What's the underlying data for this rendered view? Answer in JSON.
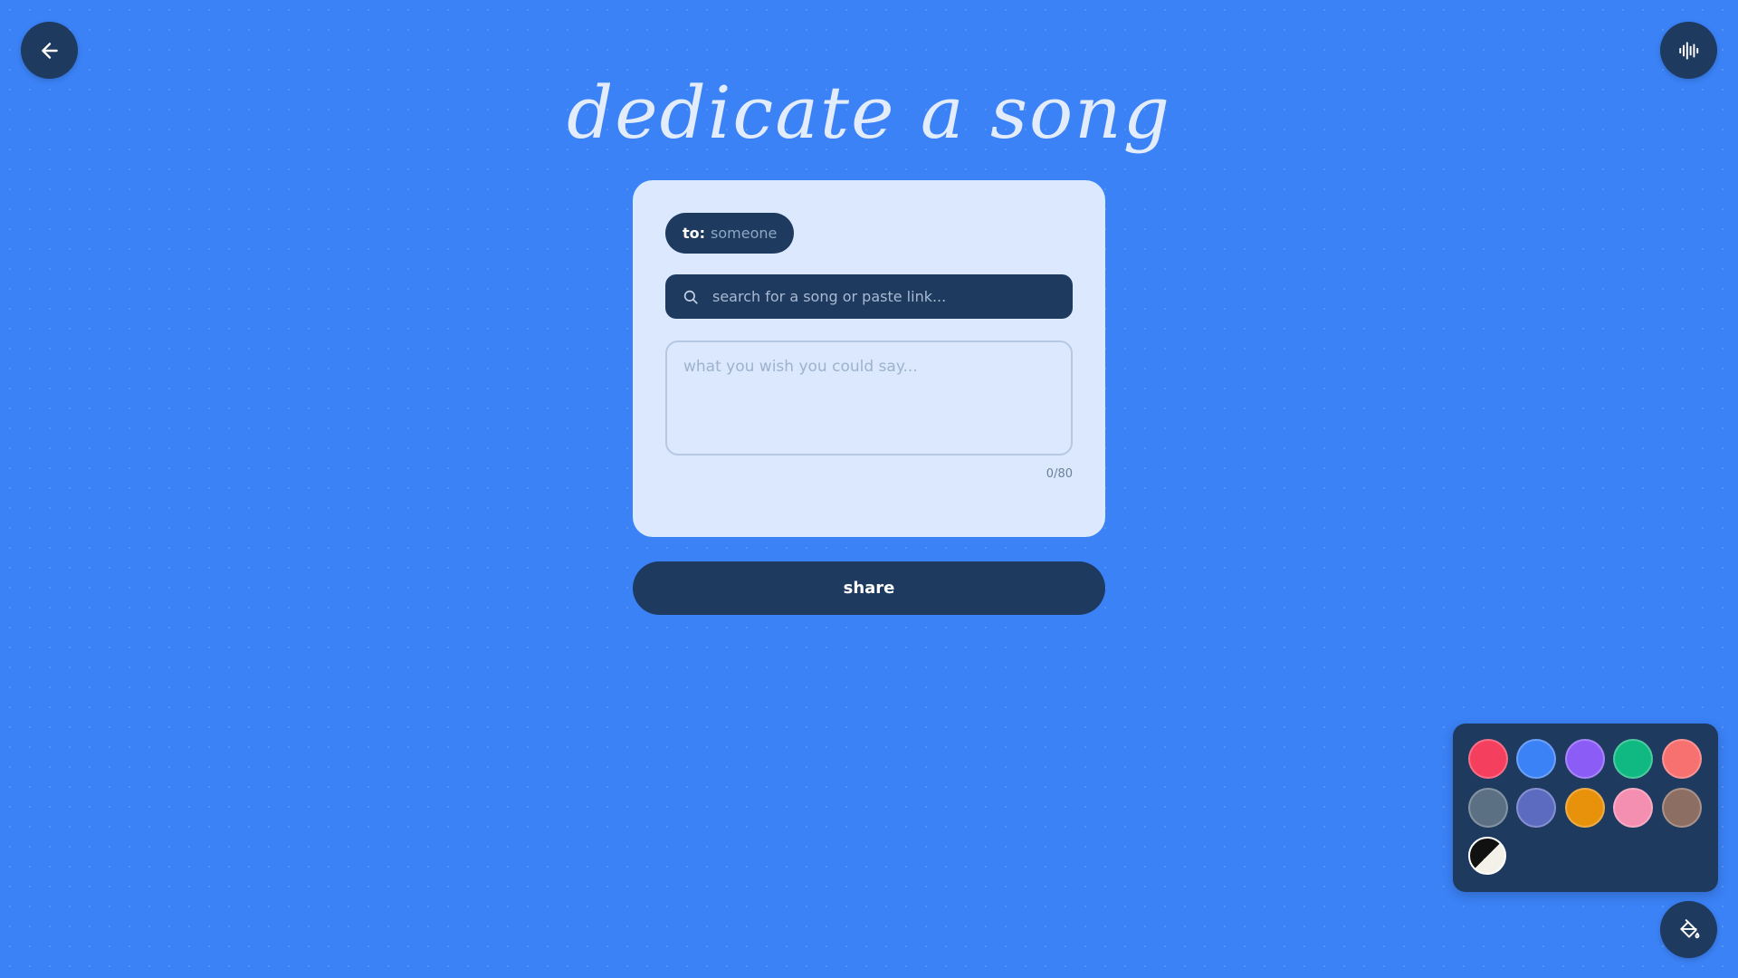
{
  "header": {
    "title": "dedicate a song",
    "back_icon": "arrow-left-icon",
    "audio_icon": "audio-waveform-icon"
  },
  "card": {
    "to_label": "to:",
    "to_value": "someone",
    "search_placeholder": "search for a song or paste link...",
    "search_icon": "search-icon",
    "message_placeholder": "what you wish you could say...",
    "char_count": "0/80"
  },
  "share": {
    "label": "share"
  },
  "palette": {
    "swatches": [
      "#f43f5e",
      "#3b82f6",
      "#8b5cf6",
      "#10b981",
      "#f87171",
      "#5b7083",
      "#5c6bc0",
      "#e8920c",
      "#f48fb1",
      "#8d6e63"
    ],
    "contrast_icon": "contrast-toggle-icon",
    "toggle_icon": "paint-bucket-icon"
  },
  "colors": {
    "background": "#3b82f6",
    "dark": "#1e3a5f",
    "card": "#dbe8fd"
  }
}
